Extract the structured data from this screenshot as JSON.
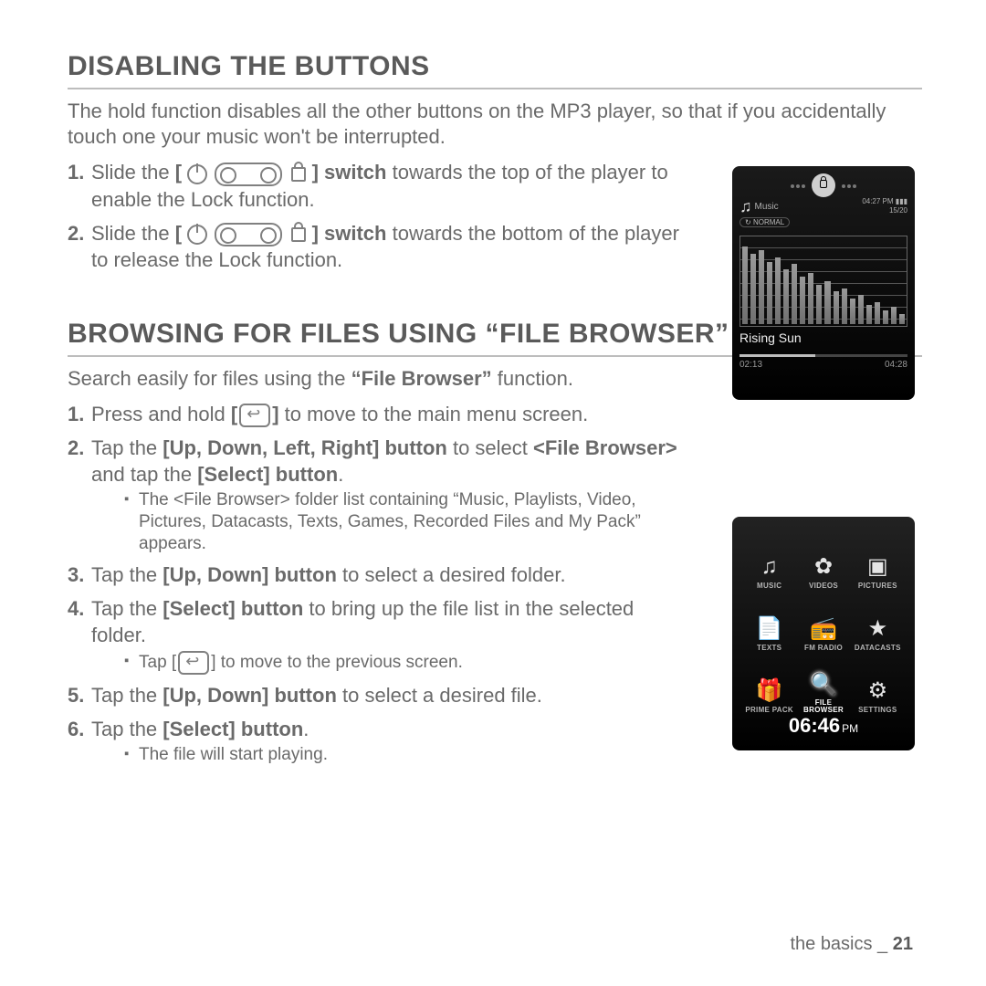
{
  "section1": {
    "title": "DISABLING THE BUTTONS",
    "lead": "The hold function disables all the other buttons on the MP3 player, so that if you accidentally touch one your music won't be interrupted.",
    "step1_a": "Slide the ",
    "step1_switch": "switch",
    "step1_b": " towards the top of the player to enable the Lock function.",
    "step2_a": "Slide the ",
    "step2_switch": "switch",
    "step2_b": " towards the bottom of the player to release the Lock function."
  },
  "player1": {
    "appLabel": "Music",
    "time": "04:27 PM",
    "trackOf": "15/20",
    "soundMode": "NORMAL",
    "song": "Rising Sun",
    "elapsed": "02:13",
    "total": "04:28"
  },
  "section2": {
    "title": "BROWSING FOR FILES USING “FILE BROWSER”",
    "lead_a": "Search easily for files using the ",
    "lead_b": "“File Browser”",
    "lead_c": " function.",
    "s1_a": "Press and hold ",
    "s1_b": " to move to the main menu screen.",
    "s2_a": "Tap the ",
    "s2_b": "[Up, Down, Left, Right] button",
    "s2_c": " to select ",
    "s2_d": "<File Browser>",
    "s2_e": " and tap the ",
    "s2_f": "[Select] button",
    "s2_g": ".",
    "s2_sub": "The <File Browser> folder list containing “Music, Playlists, Video, Pictures, Datacasts, Texts, Games, Recorded Files and My Pack” appears.",
    "s3_a": "Tap the ",
    "s3_b": "[Up, Down] button",
    "s3_c": " to select a desired folder.",
    "s4_a": "Tap the ",
    "s4_b": "[Select] button",
    "s4_c": " to bring up the file list in the selected folder.",
    "s4_sub_a": "Tap ",
    "s4_sub_b": " to move to the previous screen.",
    "s5_a": "Tap the ",
    "s5_b": "[Up, Down] button",
    "s5_c": " to select a desired file.",
    "s6_a": "Tap the ",
    "s6_b": "[Select] button",
    "s6_c": ".",
    "s6_sub": "The file will start playing."
  },
  "player2": {
    "items": [
      {
        "icon": "♫",
        "label": "MUSIC"
      },
      {
        "icon": "✿",
        "label": "VIDEOS"
      },
      {
        "icon": "▣",
        "label": "PICTURES"
      },
      {
        "icon": "📄",
        "label": "TEXTS"
      },
      {
        "icon": "📻",
        "label": "FM RADIO"
      },
      {
        "icon": "★",
        "label": "DATACASTS"
      },
      {
        "icon": "🎁",
        "label": "PRIME PACK"
      },
      {
        "icon": "🔍",
        "label": "FILE BROWSER",
        "sel": true
      },
      {
        "icon": "⚙",
        "label": "SETTINGS"
      }
    ],
    "clock": "06:46",
    "ampm": "PM"
  },
  "footer": {
    "label": "the basics _",
    "page": "21"
  }
}
